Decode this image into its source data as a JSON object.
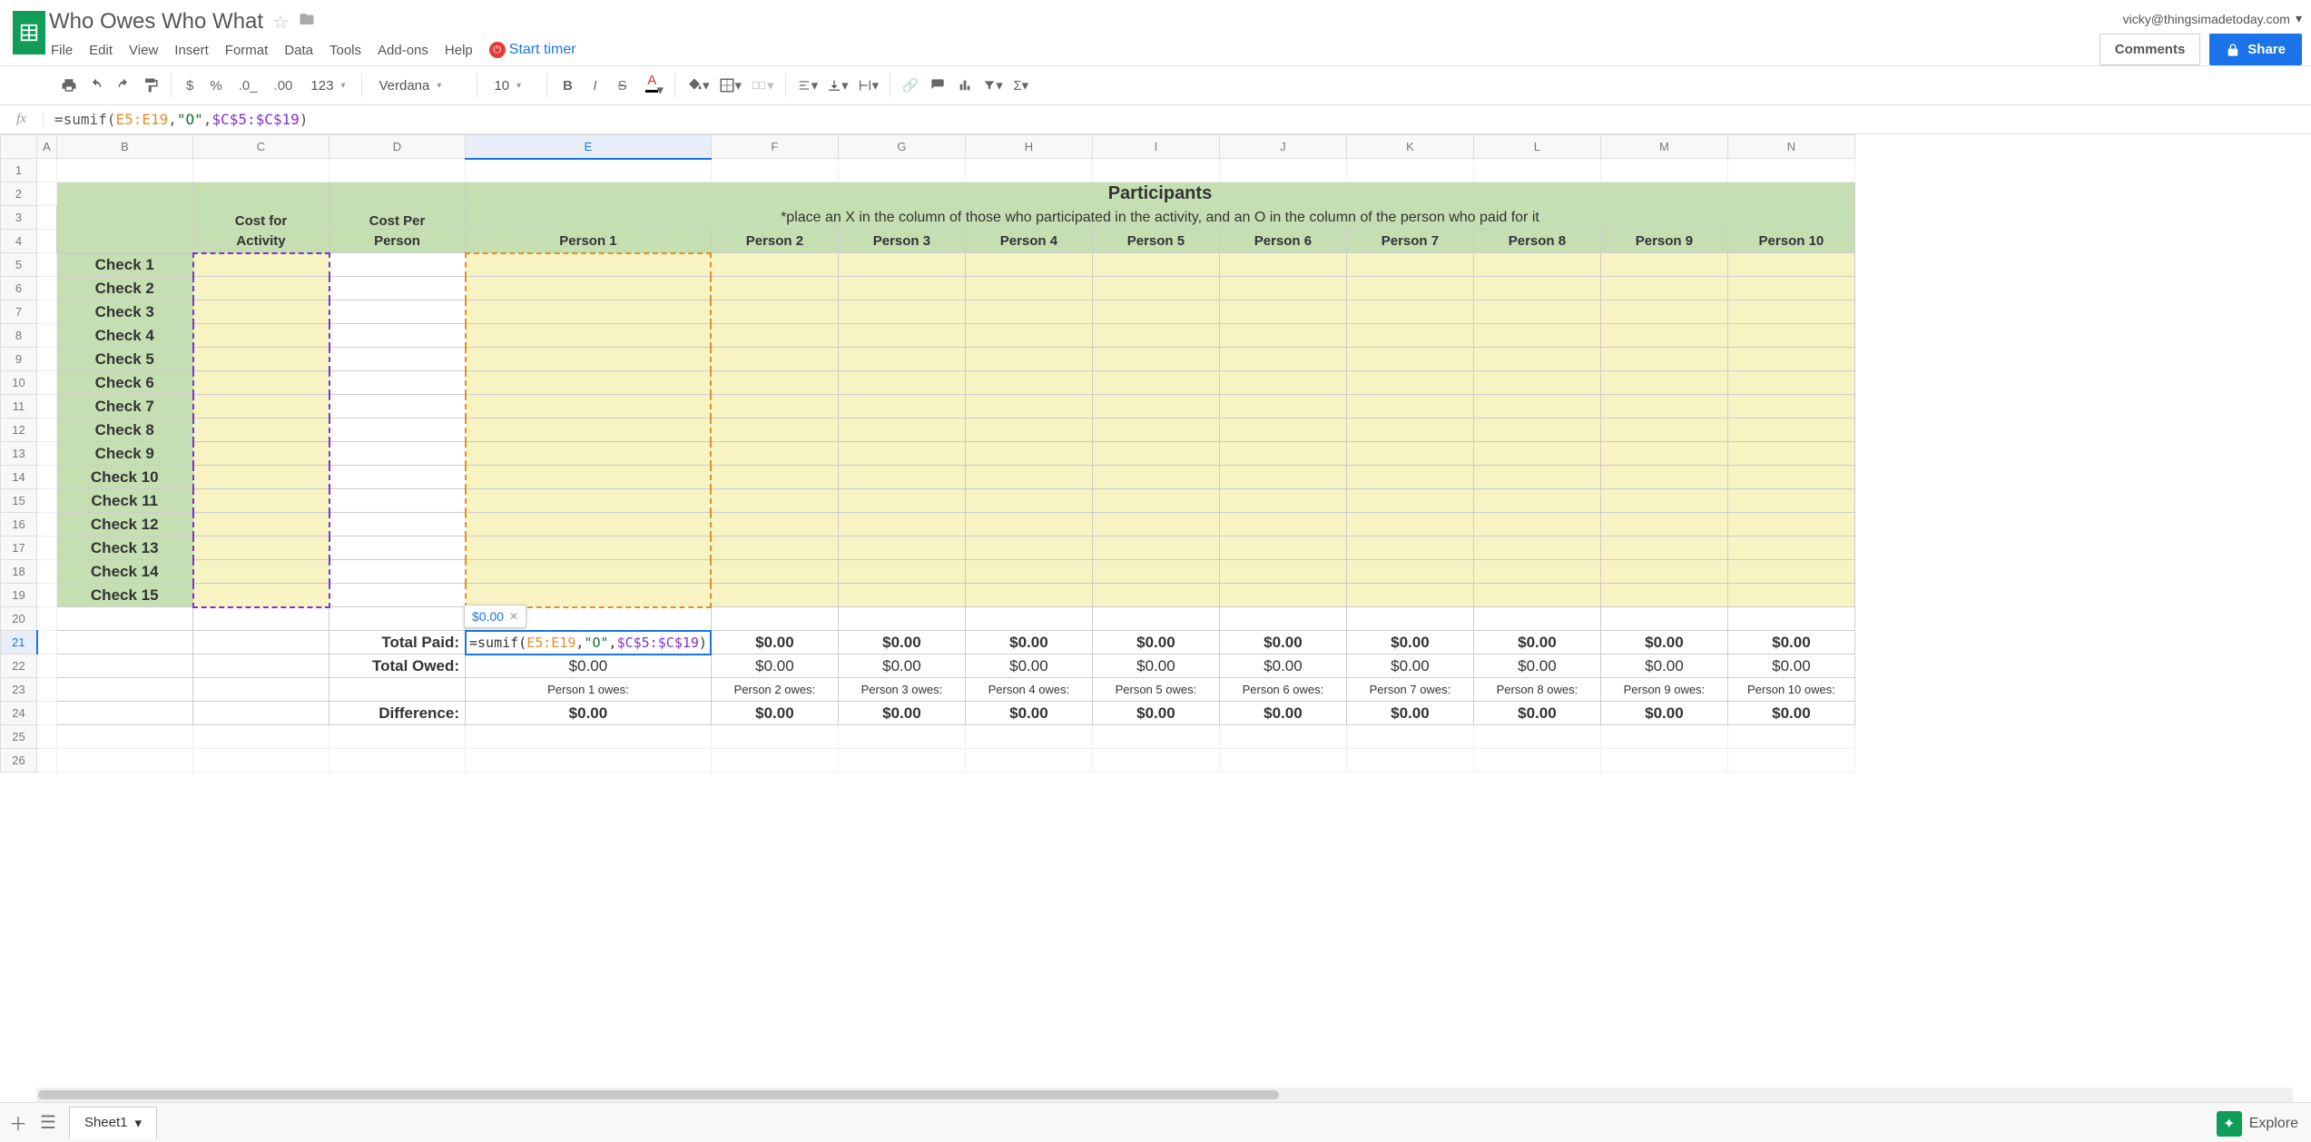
{
  "doc_title": "Who Owes Who What",
  "user_email": "vicky@thingsimadetoday.com",
  "comments_label": "Comments",
  "share_label": "Share",
  "menus": [
    "File",
    "Edit",
    "View",
    "Insert",
    "Format",
    "Data",
    "Tools",
    "Add-ons",
    "Help"
  ],
  "start_timer_label": "Start timer",
  "toolbar": {
    "font_name": "Verdana",
    "font_size": "10",
    "number_format": "123"
  },
  "formula_bar": {
    "prefix": "=sumif(",
    "range1": "E5:E19",
    "sep1": ",",
    "str": "\"O\"",
    "sep2": ",",
    "range2": "$C$5:$C$19",
    "suffix": ")"
  },
  "formula_preview": "$0.00",
  "columns": [
    "A",
    "B",
    "C",
    "D",
    "E",
    "F",
    "G",
    "H",
    "I",
    "J",
    "K",
    "L",
    "M",
    "N"
  ],
  "selected_col": "E",
  "selected_row": 21,
  "headers": {
    "participants": "Participants",
    "cost_activity_l1": "Cost for",
    "cost_activity_l2": "Activity",
    "cost_person_l1": "Cost Per",
    "cost_person_l2": "Person",
    "instruction": "*place an X in the column of those who participated in the activity, and an O in the column of the person who paid for it"
  },
  "persons": [
    "Person 1",
    "Person 2",
    "Person 3",
    "Person 4",
    "Person 5",
    "Person 6",
    "Person 7",
    "Person 8",
    "Person 9",
    "Person 10"
  ],
  "checks": [
    "Check 1",
    "Check 2",
    "Check 3",
    "Check 4",
    "Check 5",
    "Check 6",
    "Check 7",
    "Check 8",
    "Check 9",
    "Check 10",
    "Check 11",
    "Check 12",
    "Check 13",
    "Check 14",
    "Check 15"
  ],
  "totals": {
    "paid_label": "Total Paid:",
    "owed_label": "Total Owed:",
    "diff_label": "Difference:"
  },
  "paid_values": [
    "",
    "$0.00",
    "$0.00",
    "$0.00",
    "$0.00",
    "$0.00",
    "$0.00",
    "$0.00",
    "$0.00",
    "$0.00"
  ],
  "owed_values": [
    "$0.00",
    "$0.00",
    "$0.00",
    "$0.00",
    "$0.00",
    "$0.00",
    "$0.00",
    "$0.00",
    "$0.00",
    "$0.00"
  ],
  "owes_labels": [
    "Person 1 owes:",
    "Person 2 owes:",
    "Person 3 owes:",
    "Person 4 owes:",
    "Person 5 owes:",
    "Person 6 owes:",
    "Person 7 owes:",
    "Person 8 owes:",
    "Person 9 owes:",
    "Person 10 owes:"
  ],
  "diff_values": [
    "$0.00",
    "$0.00",
    "$0.00",
    "$0.00",
    "$0.00",
    "$0.00",
    "$0.00",
    "$0.00",
    "$0.00",
    "$0.00"
  ],
  "active_cell_partial": "$0.00",
  "sheet_tab": "Sheet1",
  "explore_label": "Explore"
}
